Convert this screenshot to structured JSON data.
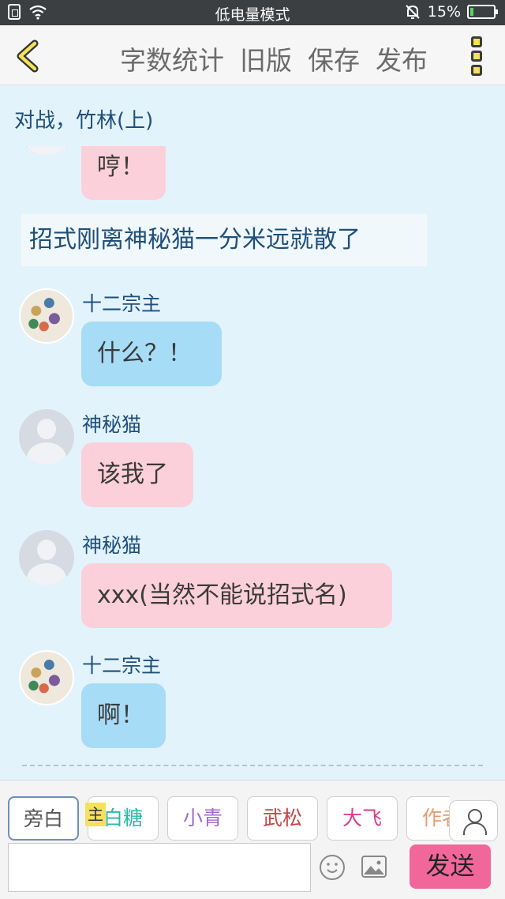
{
  "status_bar": {
    "mode_text": "低电量模式",
    "battery_text": "15%",
    "battery_level": 0.15,
    "icons": [
      "sim-icon",
      "wifi-icon",
      "mute-bell-icon",
      "battery-icon"
    ]
  },
  "toolbar": {
    "back_icon": "chevron-left-icon",
    "word_count": "字数统计",
    "old_version": "旧版",
    "save": "保存",
    "publish": "发布",
    "more_icon": "more-vertical-icon"
  },
  "chapter_title": "对战，竹林(上)",
  "messages": [
    {
      "type": "partial",
      "text": "哼！",
      "color": "#fcd0da"
    },
    {
      "type": "narration",
      "text": "招式刚离神秘猫一分米远就散了"
    },
    {
      "type": "message",
      "author": "十二宗主",
      "avatar": "host-avatar-image",
      "text": "什么？！",
      "color": "#a7dcf7"
    },
    {
      "type": "message",
      "author": "神秘猫",
      "avatar": "default-avatar-icon",
      "text": "该我了",
      "color": "#fcd0da"
    },
    {
      "type": "message",
      "author": "神秘猫",
      "avatar": "default-avatar-icon",
      "text": "xxx(当然不能说招式名)",
      "color": "#fcd0da"
    },
    {
      "type": "message",
      "author": "十二宗主",
      "avatar": "host-avatar-image",
      "text": "啊！",
      "color": "#a7dcf7"
    }
  ],
  "composer": {
    "roles": [
      {
        "label": "旁白",
        "color": "#555555"
      },
      {
        "label": "白糖",
        "color": "#2ab8a7"
      },
      {
        "label": "小青",
        "color": "#a368c8"
      },
      {
        "label": "武松",
        "color": "#c64545"
      },
      {
        "label": "大飞",
        "color": "#d43f8d"
      },
      {
        "label": "作者",
        "color": "#e79a6a"
      }
    ],
    "host_badge": "主",
    "input_value": "",
    "input_placeholder": "",
    "send_label": "发送",
    "icons": [
      "contacts-icon",
      "emoji-icon",
      "image-icon"
    ]
  },
  "colors": {
    "chat_background": "#e3f3fb",
    "send_button": "#f2679a",
    "accent_yellow": "#f4e25a"
  }
}
